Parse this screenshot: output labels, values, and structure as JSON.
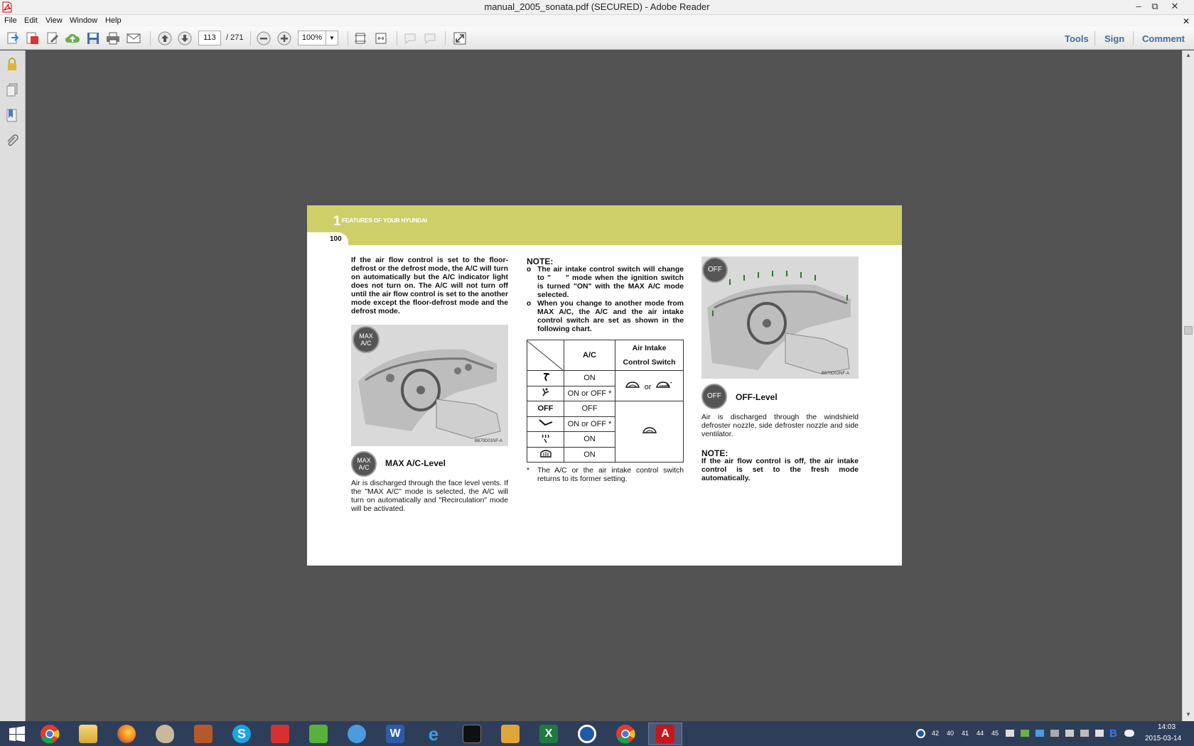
{
  "window": {
    "title": "manual_2005_sonata.pdf (SECURED) - Adobe Reader",
    "controls": {
      "minimize": "–",
      "restore": "⧉",
      "close": "✕",
      "doc_close": "✕"
    }
  },
  "menu": [
    "File",
    "Edit",
    "View",
    "Window",
    "Help"
  ],
  "toolbar": {
    "current_page": "113",
    "page_total": "/ 271",
    "zoom": "100%",
    "right_links": [
      "Tools",
      "Sign",
      "Comment"
    ]
  },
  "page": {
    "chapter_number": "1",
    "chapter_title": "FEATURES OF YOUR HYUNDAI",
    "page_number": "100",
    "left_intro": "If the air flow control is set to the floor-defrost or the defrost mode, the A/C will turn on automatically but the A/C indicator light does not turn on. The A/C will not turn off until the air flow control is set to the another mode except the floor-defrost mode and the defrost mode.",
    "fig1_badge": "MAX A/C",
    "fig1_code": "B670D01NF-A",
    "maxac_badge": "MAX A/C",
    "maxac_title": "MAX A/C-Level",
    "maxac_body": "Air is discharged through the face level vents. If the \"MAX A/C\" mode is selected, the A/C will turn on automatically and \"Recirculation\" mode will be activated.",
    "note_title": "NOTE:",
    "note_bullet": "o",
    "note1": "The air intake control switch will change to \"  \" mode when the ignition switch is turned \"ON\" with the MAX A/C mode selected.",
    "note2": "When you change to another mode from MAX A/C, the A/C and the air intake control switch are set as shown in the following chart.",
    "table": {
      "col_ac": "A/C",
      "col_intake_1": "Air Intake",
      "col_intake_2": "Control Switch",
      "rows": [
        "ON",
        "ON or OFF *",
        "OFF",
        "ON or OFF *",
        "ON",
        "ON"
      ],
      "off_mode_label": "OFF",
      "or_text": "or"
    },
    "footnote_mark": "*",
    "footnote": "The A/C or the air intake control switch returns to its former setting.",
    "fig2_badge": "OFF",
    "fig2_code": "B670D02NF-A",
    "off_badge": "OFF",
    "off_title": "OFF-Level",
    "off_body": "Air is discharged through the windshield defroster nozzle, side defroster nozzle and side ventilator.",
    "note2_title": "NOTE:",
    "note2_body": "If the air flow control is off, the air intake control is set to the fresh mode automatically."
  },
  "taskbar": {
    "tray_numbers": [
      "42",
      "40",
      "41",
      "44",
      "45"
    ],
    "time": "14:03",
    "date": "2015-03-14"
  },
  "colors": {
    "header_band": "#cfcf6a",
    "viewer_bg": "#535353",
    "taskbar": "#2f3e58",
    "link_blue": "#3c6e9e"
  }
}
